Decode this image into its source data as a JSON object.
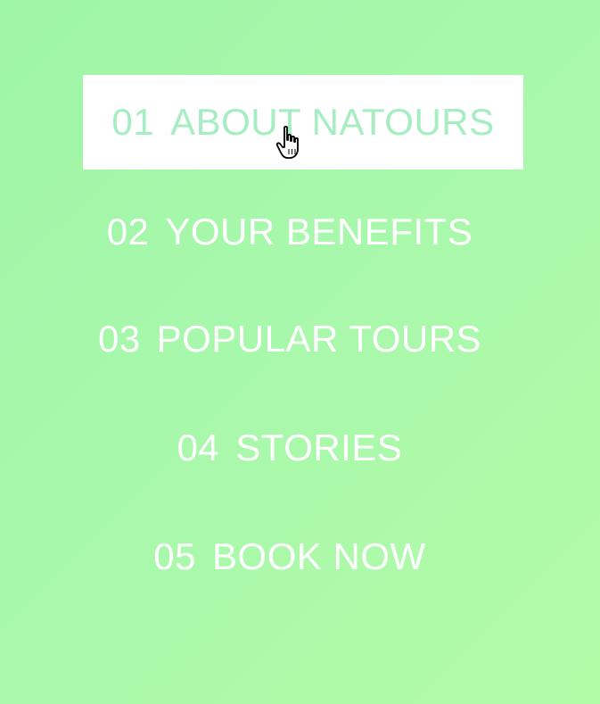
{
  "nav": {
    "items": [
      {
        "number": "01",
        "label": "ABOUT NATOURS",
        "state": "hovered"
      },
      {
        "number": "02",
        "label": "YOUR BENEFITS"
      },
      {
        "number": "03",
        "label": "POPULAR TOURS"
      },
      {
        "number": "04",
        "label": "STORIES"
      },
      {
        "number": "05",
        "label": "BOOK NOW"
      }
    ]
  },
  "colors": {
    "background_start": "#9ff5a6",
    "background_end": "#b2fba7",
    "text": "#ffffff",
    "active_background": "#ffffff",
    "active_text": "#a6eec2"
  },
  "cursor": {
    "icon": "hand-pointer-icon"
  }
}
